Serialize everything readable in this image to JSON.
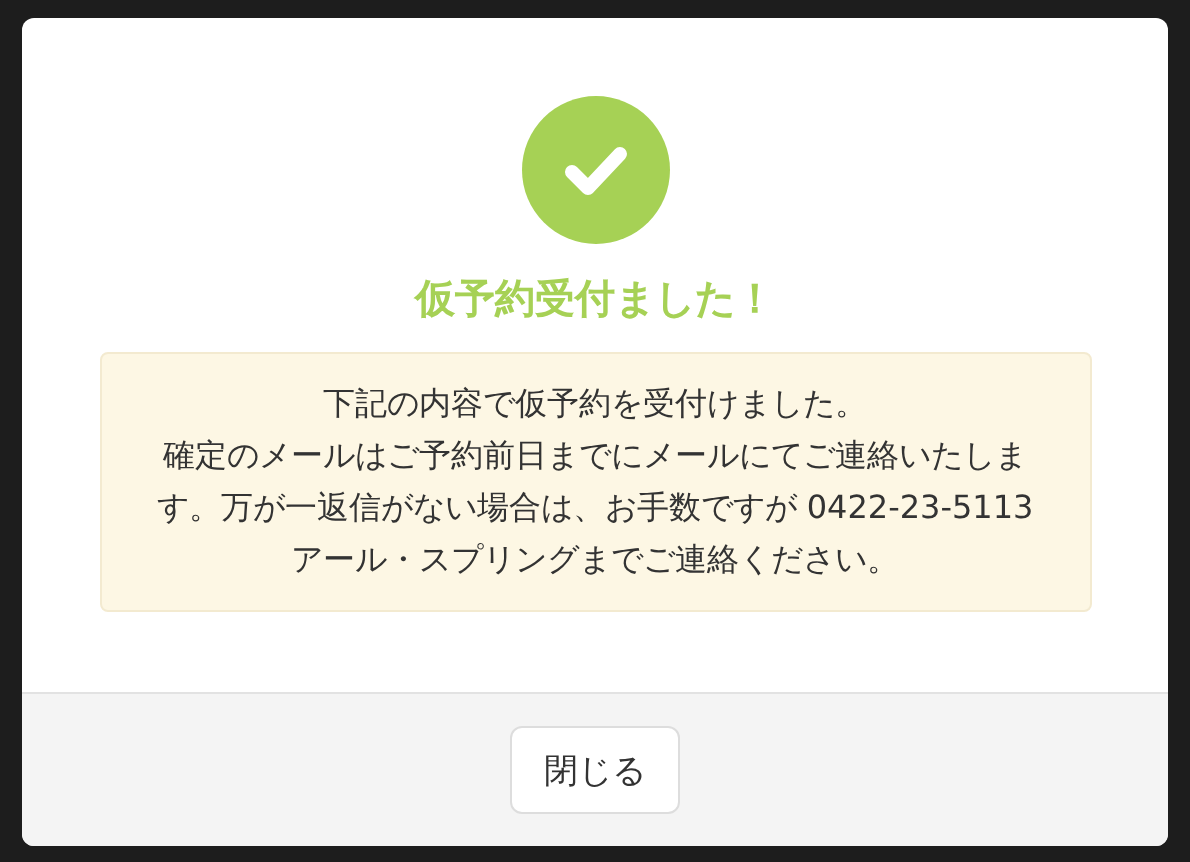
{
  "dialog": {
    "title": "仮予約受付ました！",
    "message": [
      "下記の内容で仮予約を受付けました。",
      "確定のメールはご予約前日までにメールにてご連絡いたします。万が一返信がない場合は、お手数ですが 0422-23-5113",
      "アール・スプリングまでご連絡ください。"
    ],
    "buttons": [
      "閉じる"
    ]
  }
}
